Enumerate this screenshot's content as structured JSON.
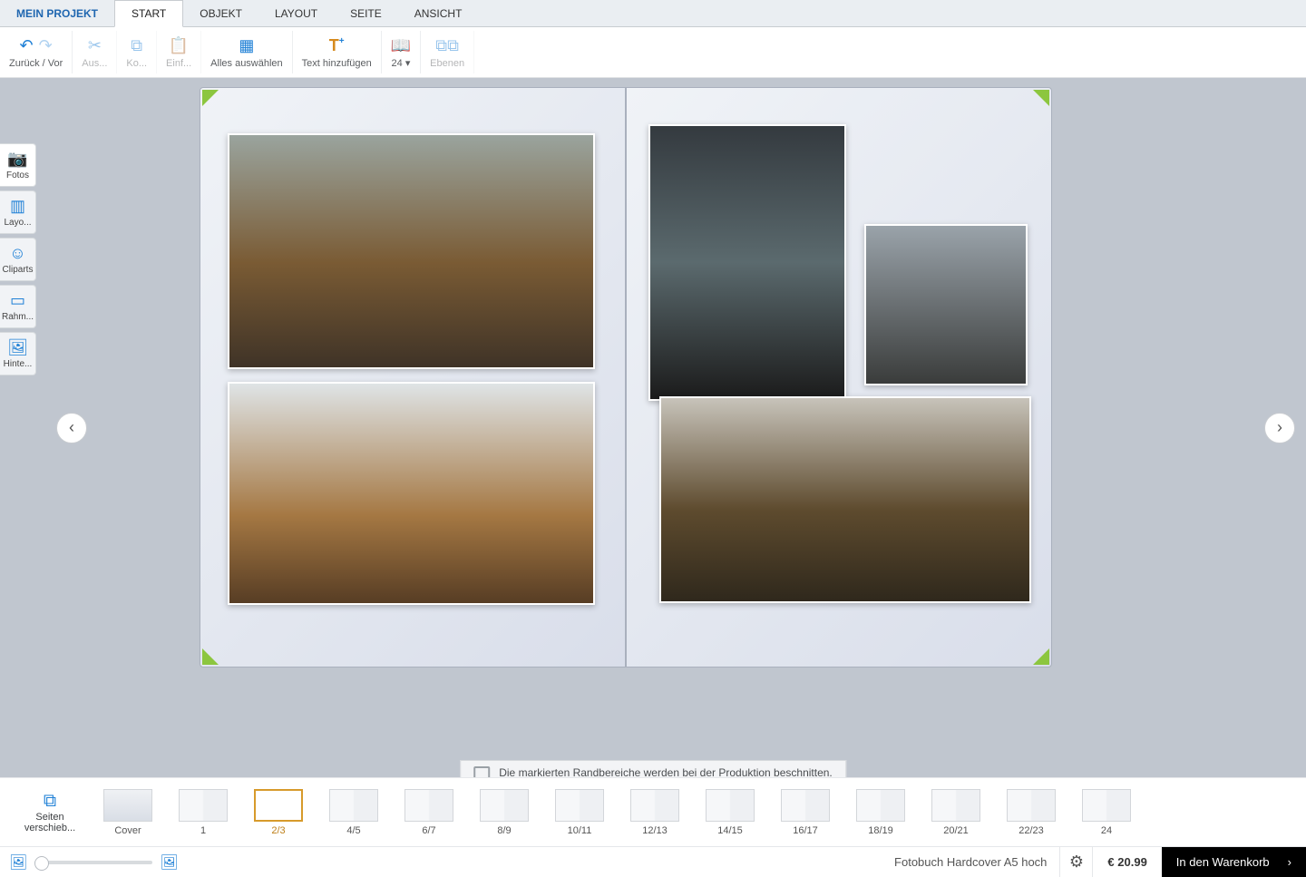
{
  "menu": {
    "tabs": [
      "MEIN PROJEKT",
      "START",
      "OBJEKT",
      "LAYOUT",
      "SEITE",
      "ANSICHT"
    ],
    "active": "START"
  },
  "ribbon": {
    "undo_redo": "Zurück / Vor",
    "cut": "Aus...",
    "copy": "Ko...",
    "paste": "Einf...",
    "select_all": "Alles auswählen",
    "add_text": "Text hinzufügen",
    "font_size": "24",
    "layers": "Ebenen"
  },
  "palette": {
    "items": [
      "Fotos",
      "Layo...",
      "Cliparts",
      "Rahm...",
      "Hinte..."
    ],
    "active": 0
  },
  "crop_message": "Die markierten Randbereiche werden bei der Produktion beschnitten.",
  "thumbs": {
    "move_label1": "Seiten",
    "move_label2": "verschieb...",
    "items": [
      "Cover",
      "1",
      "2/3",
      "4/5",
      "6/7",
      "8/9",
      "10/11",
      "12/13",
      "14/15",
      "16/17",
      "18/19",
      "20/21",
      "22/23",
      "24"
    ],
    "active_index": 2
  },
  "status": {
    "product_name": "Fotobuch Hardcover A5 hoch",
    "price": "€ 20.99",
    "cart_label": "In den Warenkorb"
  }
}
